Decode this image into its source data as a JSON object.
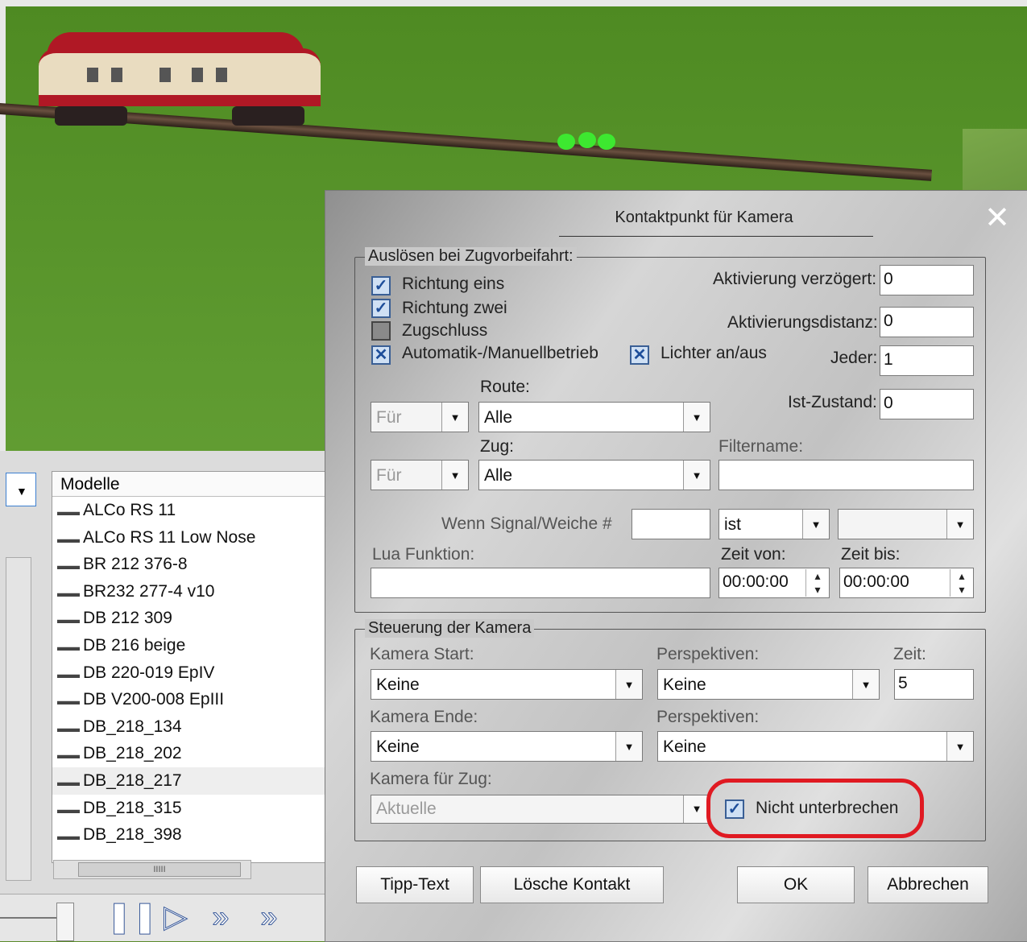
{
  "scene": {
    "contact_color": "#3de830"
  },
  "models_panel": {
    "header": "Modelle",
    "items": [
      "ALCo RS 11",
      "ALCo RS 11 Low Nose",
      "BR 212 376-8",
      "BR232 277-4 v10",
      "DB 212 309",
      "DB 216 beige",
      "DB 220-019 EpIV",
      "DB V200-008 EpIII",
      "DB_218_134",
      "DB_218_202",
      "DB_218_217",
      "DB_218_315",
      "DB_218_398"
    ],
    "selected_index": 10
  },
  "dialog": {
    "title": "Kontaktpunkt für Kamera",
    "close": "✕",
    "trigger_group": {
      "legend": "Auslösen bei Zugvorbeifahrt:",
      "richtung_eins": "Richtung eins",
      "richtung_zwei": "Richtung zwei",
      "zugschluss": "Zugschluss",
      "automatik": "Automatik-/Manuellbetrieb",
      "lichter": "Lichter an/aus",
      "aktivierung_verzoegert_label": "Aktivierung verzögert:",
      "aktivierung_verzoegert_value": "0",
      "aktivierungsdistanz_label": "Aktivierungsdistanz:",
      "aktivierungsdistanz_value": "0",
      "jeder_label": "Jeder:",
      "jeder_value": "1",
      "ist_zustand_label": "Ist-Zustand:",
      "ist_zustand_value": "0",
      "route_label": "Route:",
      "route_fuer": "Für",
      "route_value": "Alle",
      "zug_label": "Zug:",
      "zug_fuer": "Für",
      "zug_value": "Alle",
      "filtername_label": "Filtername:",
      "filtername_value": "",
      "signal_label": "Wenn Signal/Weiche #",
      "signal_value": "",
      "signal_state": "ist",
      "signal_state2": "",
      "lua_label": "Lua Funktion:",
      "lua_value": "",
      "zeit_von_label": "Zeit von:",
      "zeit_von_value": "00:00:00",
      "zeit_bis_label": "Zeit bis:",
      "zeit_bis_value": "00:00:00"
    },
    "camera_group": {
      "legend": "Steuerung der Kamera",
      "kamera_start_label": "Kamera Start:",
      "kamera_start_value": "Keine",
      "perspektiven1_label": "Perspektiven:",
      "perspektiven1_value": "Keine",
      "zeit_label": "Zeit:",
      "zeit_value": "5",
      "kamera_ende_label": "Kamera Ende:",
      "kamera_ende_value": "Keine",
      "perspektiven2_label": "Perspektiven:",
      "perspektiven2_value": "Keine",
      "kamera_zug_label": "Kamera für Zug:",
      "kamera_zug_value": "Aktuelle",
      "nicht_unterbrechen": "Nicht unterbrechen"
    },
    "buttons": {
      "tipp_text": "Tipp-Text",
      "loesche_kontakt": "Lösche Kontakt",
      "ok": "OK",
      "abbrechen": "Abbrechen"
    }
  },
  "check": "✓",
  "xmark": "✕"
}
